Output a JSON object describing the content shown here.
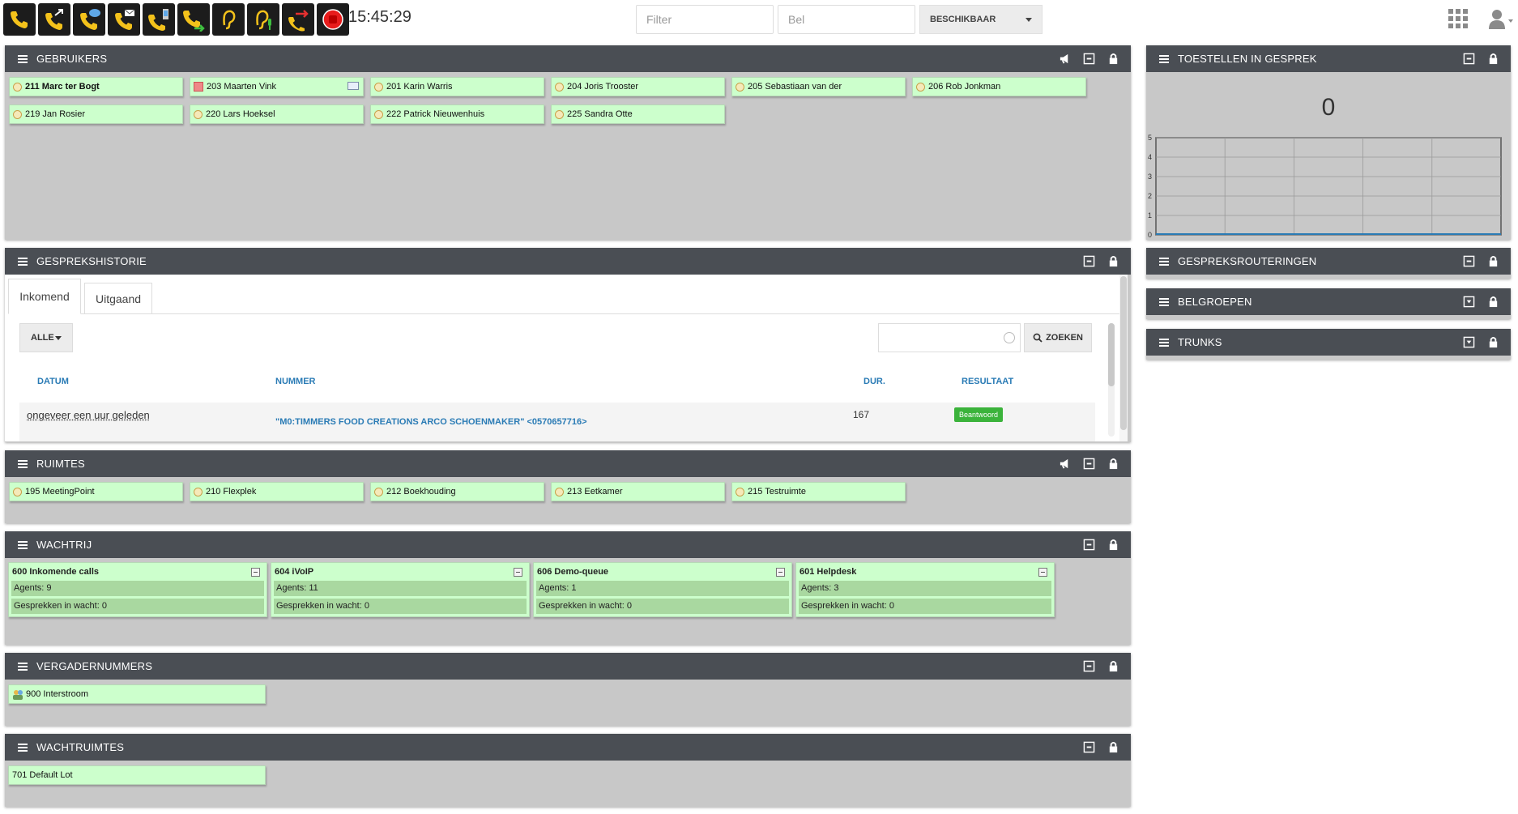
{
  "toolbar": {
    "buttons": [
      {
        "name": "phone-icon"
      },
      {
        "name": "call-forward-icon"
      },
      {
        "name": "call-message-icon"
      },
      {
        "name": "call-mail-icon"
      },
      {
        "name": "call-mobile-icon"
      },
      {
        "name": "call-transfer-icon"
      },
      {
        "name": "listen-icon"
      },
      {
        "name": "whisper-icon"
      },
      {
        "name": "hangup-icon"
      },
      {
        "name": "record-icon"
      }
    ],
    "clock": "15:45:29",
    "filter_placeholder": "Filter",
    "call_placeholder": "Bel",
    "status": "BESCHIKBAAR"
  },
  "users_panel": {
    "title": "GEBRUIKERS",
    "items": [
      {
        "label": "211 Marc ter Bogt",
        "state": "busy"
      },
      {
        "label": "203 Maarten Vink",
        "state": "dnd"
      },
      {
        "label": "201 Karin Warris",
        "state": "available"
      },
      {
        "label": "204 Joris Trooster",
        "state": "available"
      },
      {
        "label": "205 Sebastiaan van der",
        "state": "available"
      },
      {
        "label": "206 Rob Jonkman",
        "state": "available"
      },
      {
        "label": "219 Jan Rosier",
        "state": "available"
      },
      {
        "label": "220 Lars Hoeksel",
        "state": "available"
      },
      {
        "label": "222 Patrick Nieuwenhuis",
        "state": "available"
      },
      {
        "label": "225 Sandra Otte",
        "state": "available"
      }
    ]
  },
  "devices_panel": {
    "title": "TOESTELLEN IN GESPREK",
    "count": "0",
    "chart_data": {
      "type": "line",
      "y_ticks": [
        "0",
        "1",
        "2",
        "3",
        "4",
        "5"
      ],
      "ylim": [
        0,
        5
      ],
      "series": [
        {
          "values": [
            0,
            0,
            0,
            0,
            0,
            0
          ]
        }
      ],
      "grid": true
    }
  },
  "history_panel": {
    "title": "GESPREKSHISTORIE",
    "tabs": [
      "Inkomend",
      "Uitgaand"
    ],
    "filter": "ALLE",
    "search_button": "ZOEKEN",
    "columns": [
      "DATUM",
      "NUMMER",
      "DUR.",
      "RESULTAAT"
    ],
    "rows": [
      {
        "date": "ongeveer een uur geleden",
        "number": "\"M0:TIMMERS FOOD CREATIONS ARCO SCHOENMAKER\" <0570657716>",
        "duration": "167",
        "result": "Beantwoord"
      }
    ]
  },
  "routing_panel": {
    "title": "GESPREKSROUTERINGEN"
  },
  "ringgroups_panel": {
    "title": "BELGROEPEN"
  },
  "trunks_panel": {
    "title": "TRUNKS"
  },
  "rooms_panel": {
    "title": "RUIMTES",
    "items": [
      "195 MeetingPoint",
      "210 Flexplek",
      "212 Boekhouding",
      "213 Eetkamer",
      "215 Testruimte"
    ]
  },
  "queue_panel": {
    "title": "WACHTRIJ",
    "queues": [
      {
        "title": "600 Inkomende calls",
        "agents": "Agents: 9",
        "waiting": "Gesprekken in wacht: 0"
      },
      {
        "title": "604 iVoIP",
        "agents": "Agents: 11",
        "waiting": "Gesprekken in wacht: 0"
      },
      {
        "title": "606 Demo-queue",
        "agents": "Agents: 1",
        "waiting": "Gesprekken in wacht: 0"
      },
      {
        "title": "601 Helpdesk",
        "agents": "Agents: 3",
        "waiting": "Gesprekken in wacht: 0"
      }
    ]
  },
  "conference_panel": {
    "title": "VERGADERNUMMERS",
    "items": [
      "900 Interstroom"
    ]
  },
  "parking_panel": {
    "title": "WACHTRUIMTES",
    "items": [
      "701 Default Lot"
    ]
  },
  "colors": {
    "header": "#4a4e54",
    "chip": "#ccffcc",
    "link": "#2a7bb5",
    "badge": "#3bb33b"
  }
}
